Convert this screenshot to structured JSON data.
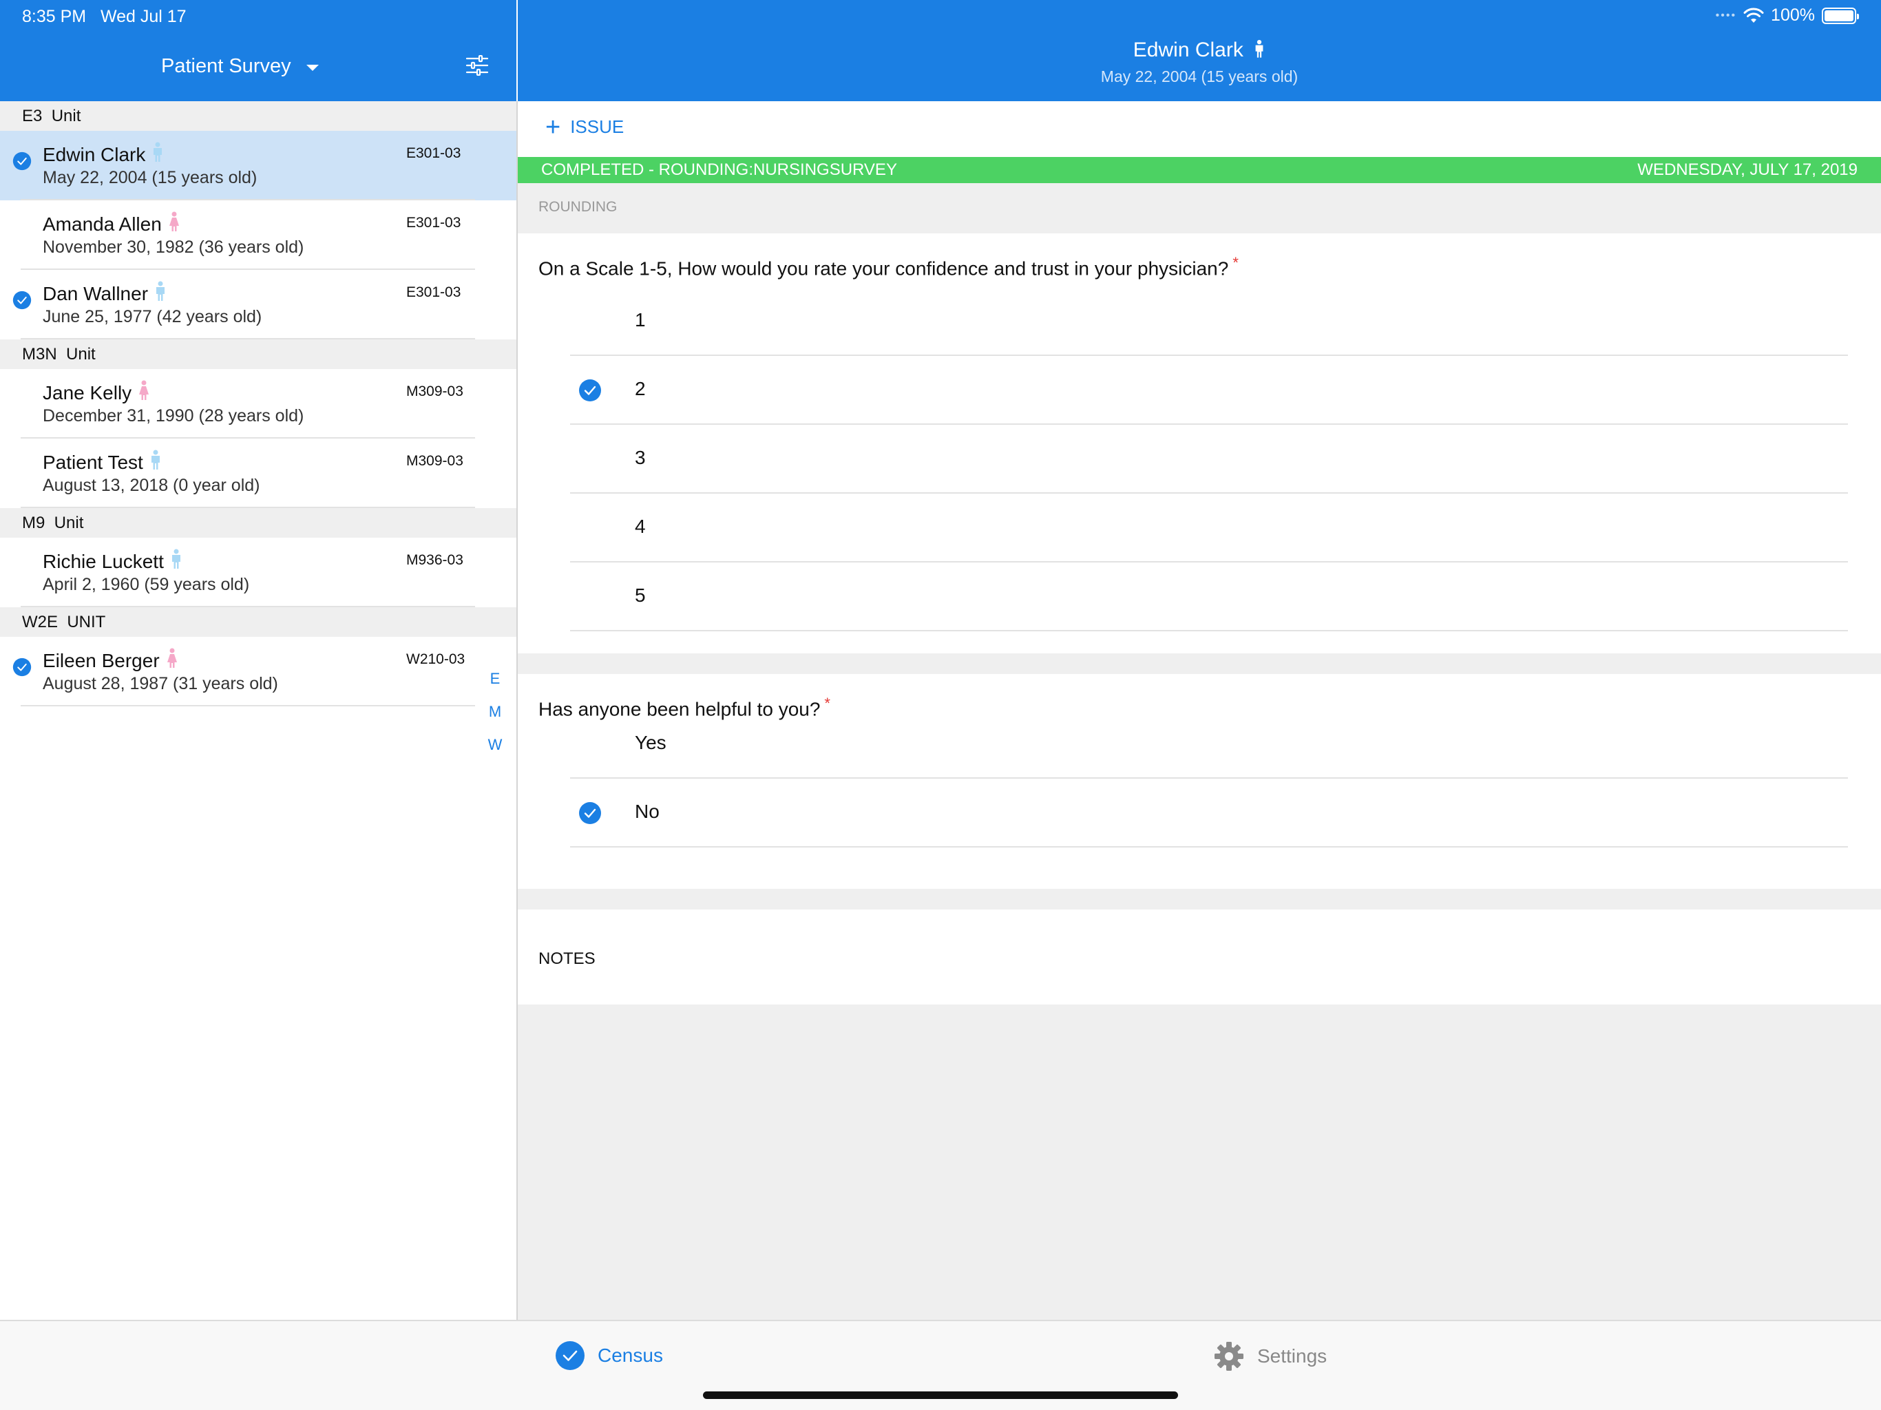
{
  "status_bar": {
    "time": "8:35 PM",
    "date": "Wed Jul 17",
    "battery": "100%"
  },
  "sidebar": {
    "title": "Patient Survey",
    "units": [
      {
        "label": "E3  Unit",
        "patients": [
          {
            "name": "Edwin Clark",
            "dob": "May 22, 2004 (15 years old)",
            "room": "E301-03",
            "gender": "male",
            "completed": true,
            "selected": true
          },
          {
            "name": "Amanda Allen",
            "dob": "November 30, 1982 (36 years old)",
            "room": "E301-03",
            "gender": "female",
            "completed": false,
            "selected": false
          },
          {
            "name": "Dan Wallner",
            "dob": "June 25, 1977 (42 years old)",
            "room": "E301-03",
            "gender": "male",
            "completed": true,
            "selected": false
          }
        ]
      },
      {
        "label": "M3N  Unit",
        "patients": [
          {
            "name": "Jane Kelly",
            "dob": "December 31, 1990 (28 years old)",
            "room": "M309-03",
            "gender": "female",
            "completed": false,
            "selected": false
          },
          {
            "name": "Patient Test",
            "dob": "August 13, 2018 (0 year old)",
            "room": "M309-03",
            "gender": "male",
            "completed": false,
            "selected": false
          }
        ]
      },
      {
        "label": "M9  Unit",
        "patients": [
          {
            "name": "Richie Luckett",
            "dob": "April 2, 1960 (59 years old)",
            "room": "M936-03",
            "gender": "male",
            "completed": false,
            "selected": false
          }
        ]
      },
      {
        "label": "W2E  UNIT",
        "patients": [
          {
            "name": "Eileen Berger",
            "dob": "August 28, 1987 (31 years old)",
            "room": "W210-03",
            "gender": "female",
            "completed": true,
            "selected": false
          }
        ]
      }
    ],
    "index": [
      "E",
      "M",
      "W"
    ]
  },
  "patient_header": {
    "name": "Edwin Clark",
    "dob": "May 22, 2004 (15 years old)"
  },
  "toolbar": {
    "issue_label": "ISSUE"
  },
  "survey_status": {
    "left": "COMPLETED - ROUNDING:NURSINGSURVEY",
    "right": "WEDNESDAY, JULY 17, 2019"
  },
  "section_label": "ROUNDING",
  "questions": [
    {
      "text": "On a Scale 1-5, How would you rate your confidence and trust in your physician?",
      "required_mark": "*",
      "options": [
        {
          "label": "1",
          "selected": false
        },
        {
          "label": "2",
          "selected": true
        },
        {
          "label": "3",
          "selected": false
        },
        {
          "label": "4",
          "selected": false
        },
        {
          "label": "5",
          "selected": false
        }
      ]
    },
    {
      "text": "Has anyone been helpful to you?",
      "required_mark": "*",
      "options": [
        {
          "label": "Yes",
          "selected": false
        },
        {
          "label": "No",
          "selected": true
        }
      ]
    }
  ],
  "notes_label": "NOTES",
  "tabs": {
    "census": "Census",
    "settings": "Settings"
  },
  "colors": {
    "primary": "#1b7fe3",
    "completed": "#4cd263",
    "selected_row": "#cde2f7",
    "male_icon": "#a8d8f5",
    "female_icon": "#f5a8c8",
    "required": "#e53935"
  }
}
